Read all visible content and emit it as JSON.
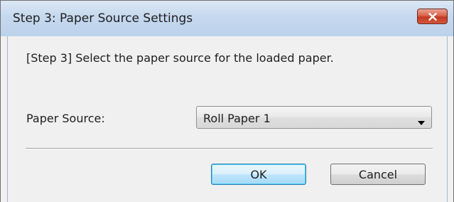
{
  "window": {
    "title": "Step 3: Paper Source Settings",
    "close_icon": "close-icon",
    "accent": "#c23a22"
  },
  "content": {
    "instruction": "[Step 3] Select the paper source for the loaded paper.",
    "paper_source_label": "Paper Source:",
    "paper_source_value": "Roll Paper 1",
    "dropdown_icon": "chevron-down-icon"
  },
  "buttons": {
    "ok_label": "OK",
    "cancel_label": "Cancel"
  }
}
